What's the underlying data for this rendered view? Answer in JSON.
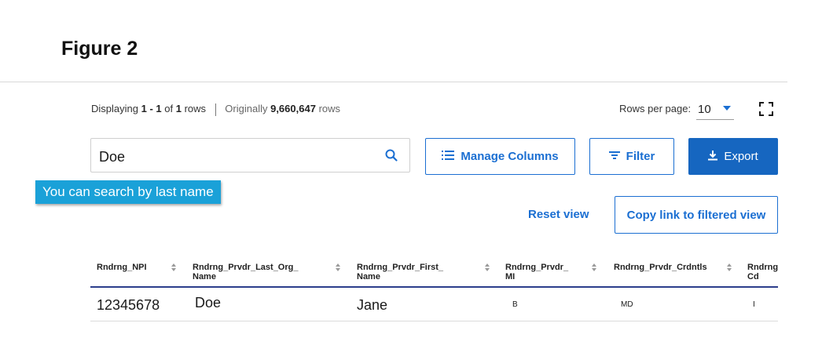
{
  "figure_title": "Figure 2",
  "display": {
    "prefix": "Displaying",
    "range": "1 - 1",
    "of": "of",
    "count": "1",
    "rows_word": "rows",
    "originally": "Originally",
    "original_count": "9,660,647",
    "original_rows_word": "rows"
  },
  "rows_per_page": {
    "label": "Rows per page:",
    "value": "10"
  },
  "search": {
    "value": "Doe",
    "placeholder": ""
  },
  "buttons": {
    "manage_columns": "Manage Columns",
    "filter": "Filter",
    "export": "Export",
    "reset_view": "Reset view",
    "copy_link": "Copy link to filtered view"
  },
  "tooltip": "You can search by last name",
  "table": {
    "headers": [
      {
        "line1": "Rndrng_NPI",
        "line2": ""
      },
      {
        "line1": "Rndrng_Prvdr_Last_Org_",
        "line2": "Name"
      },
      {
        "line1": "Rndrng_Prvdr_First_",
        "line2": "Name"
      },
      {
        "line1": "Rndrng_Prvdr_",
        "line2": "MI"
      },
      {
        "line1": "Rndrng_Prvdr_Crdntls",
        "line2": ""
      },
      {
        "line1": "Rndrng",
        "line2": "Cd"
      }
    ],
    "rows": [
      [
        "12345678",
        "Doe",
        "Jane",
        "B",
        "MD",
        "I"
      ]
    ]
  },
  "icons": {
    "search": "search-icon",
    "manage_columns": "list-icon",
    "filter": "filter-icon",
    "export": "download-icon",
    "fullscreen": "fullscreen-icon",
    "dropdown": "caret-down-icon",
    "sort": "sort-icon"
  },
  "colors": {
    "accent": "#1b6fd2",
    "export_bg": "#1666c0",
    "tooltip_bg": "#1aa1d8",
    "header_rule": "#2c3e8c"
  }
}
